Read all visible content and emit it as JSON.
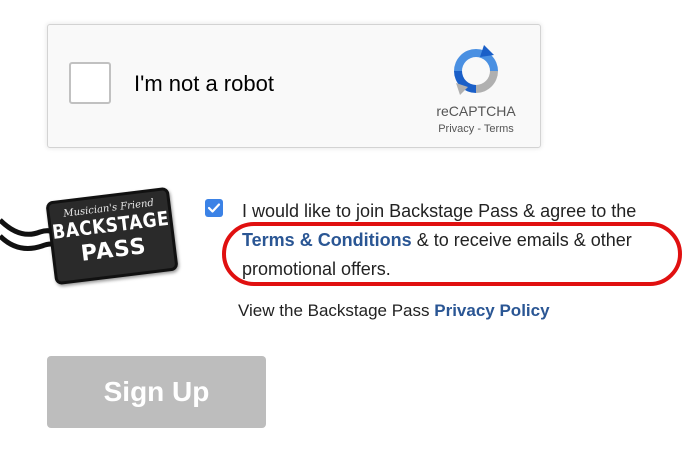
{
  "recaptcha": {
    "label": "I'm not a robot",
    "brand": "reCAPTCHA",
    "privacy_link": "Privacy",
    "separator": " - ",
    "terms_link": "Terms",
    "checked": false,
    "logo_icon": "recaptcha-logo-icon"
  },
  "badge": {
    "line1": "Musician's Friend",
    "line2": "BACKSTAGE",
    "line3": "PASS",
    "icon": "backstage-pass-badge-icon"
  },
  "consent": {
    "checked": true,
    "text_before": "I would like to join Backstage Pass & agree to the ",
    "terms_link": "Terms & Conditions",
    "text_after": " & to receive emails & other promotional offers."
  },
  "privacy": {
    "text": "View the Backstage Pass ",
    "link": "Privacy Policy"
  },
  "signup": {
    "label": "Sign Up"
  },
  "colors": {
    "link": "#2a5694",
    "checkbox_checked": "#3b82e6",
    "highlight": "#e01010",
    "button_disabled": "#bdbdbd"
  }
}
